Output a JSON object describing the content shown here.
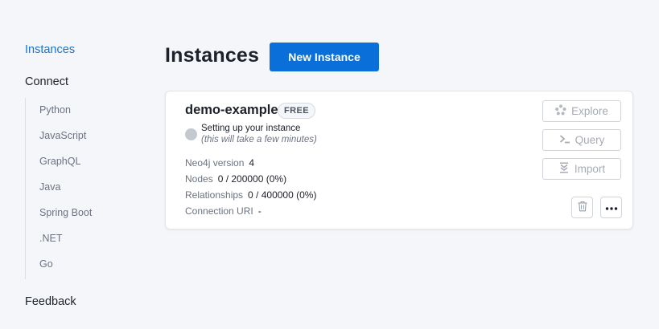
{
  "sidebar": {
    "instances": "Instances",
    "connect": "Connect",
    "connect_items": [
      "Python",
      "JavaScript",
      "GraphQL",
      "Java",
      "Spring Boot",
      ".NET",
      "Go"
    ],
    "feedback": "Feedback"
  },
  "header": {
    "title": "Instances",
    "new_instance_label": "New Instance"
  },
  "instance": {
    "name": "demo-example",
    "tier_badge": "FREE",
    "status": "Setting up your instance",
    "status_note": "(this will take a few minutes)",
    "neo4j_version_label": "Neo4j version",
    "neo4j_version": "4",
    "nodes_label": "Nodes",
    "nodes": "0 / 200000 (0%)",
    "relationships_label": "Relationships",
    "relationships": "0 / 400000 (0%)",
    "connection_uri_label": "Connection URI",
    "connection_uri": "-",
    "actions": {
      "explore": "Explore",
      "query": "Query",
      "import": "Import"
    }
  },
  "icons": {
    "explore": "explore-icon",
    "query": "terminal-icon",
    "import": "import-icon",
    "delete": "trash-icon",
    "more": "more-icon"
  },
  "colors": {
    "accent": "#0a6fd9",
    "link": "#1a73c8",
    "status_pending": "#c4c8cf"
  }
}
